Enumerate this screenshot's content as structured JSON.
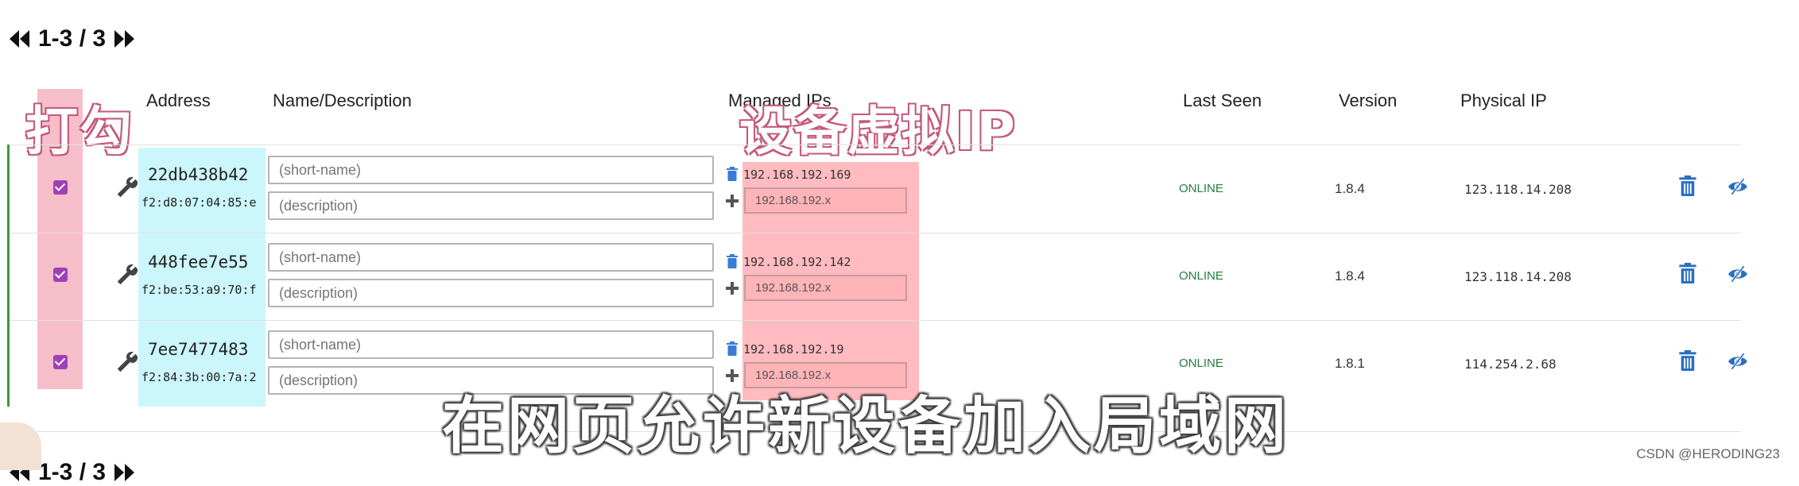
{
  "pager": {
    "top_label": "1-3 / 3",
    "bottom_label": "1-3 / 3"
  },
  "headers": {
    "address": "Address",
    "name_description": "Name/Description",
    "managed_ips": "Managed IPs",
    "last_seen": "Last Seen",
    "version": "Version",
    "physical_ip": "Physical IP"
  },
  "annotations": {
    "check_label": "打勾",
    "virtual_ip_label": "设备虚拟IP"
  },
  "subtitle": "在网页允许新设备加入局域网",
  "watermark": "CSDN @HERODING23",
  "placeholders": {
    "short_name": "(short-name)",
    "description": "(description)",
    "ip": "192.168.192.x"
  },
  "members": [
    {
      "checked": true,
      "id": "22db438b42",
      "mac": "f2:d8:07:04:85:e",
      "managed_ip": "192.168.192.169",
      "last_seen": "ONLINE",
      "version": "1.8.4",
      "physical_ip": "123.118.14.208"
    },
    {
      "checked": true,
      "id": "448fee7e55",
      "mac": "f2:be:53:a9:70:f",
      "managed_ip": "192.168.192.142",
      "last_seen": "ONLINE",
      "version": "1.8.4",
      "physical_ip": "123.118.14.208"
    },
    {
      "checked": true,
      "id": "7ee7477483",
      "mac": "f2:84:3b:00:7a:2",
      "managed_ip": "192.168.192.19",
      "last_seen": "ONLINE",
      "version": "1.8.1",
      "physical_ip": "114.254.2.68"
    }
  ],
  "colors": {
    "checkbox": "#a040b8",
    "online": "#1f7f3a",
    "action_icon": "#2a6fc0",
    "highlight_pink": "#f5b3be",
    "highlight_cyan": "#cbf6fb",
    "highlight_red": "#ff9ea4"
  }
}
